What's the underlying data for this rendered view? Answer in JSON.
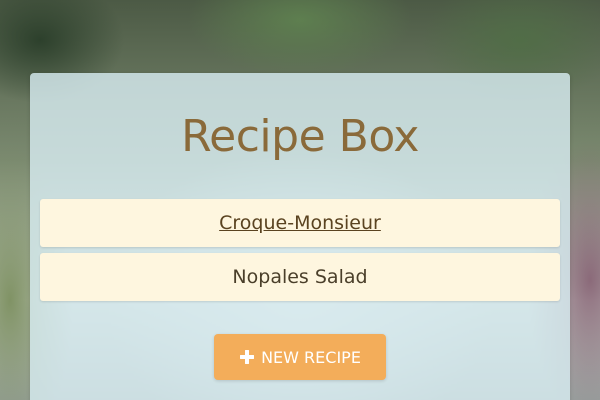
{
  "app": {
    "title": "Recipe Box"
  },
  "recipes": [
    {
      "name": "Croque-Monsieur",
      "active": true
    },
    {
      "name": "Nopales Salad",
      "active": false
    }
  ],
  "actions": {
    "new_recipe_label": "NEW RECIPE",
    "new_recipe_icon": "plus-icon"
  },
  "colors": {
    "title": "#8a6a3a",
    "button": "#f3ad5a",
    "item_background": "#fef6df",
    "card_background": "#d7ebf0"
  }
}
